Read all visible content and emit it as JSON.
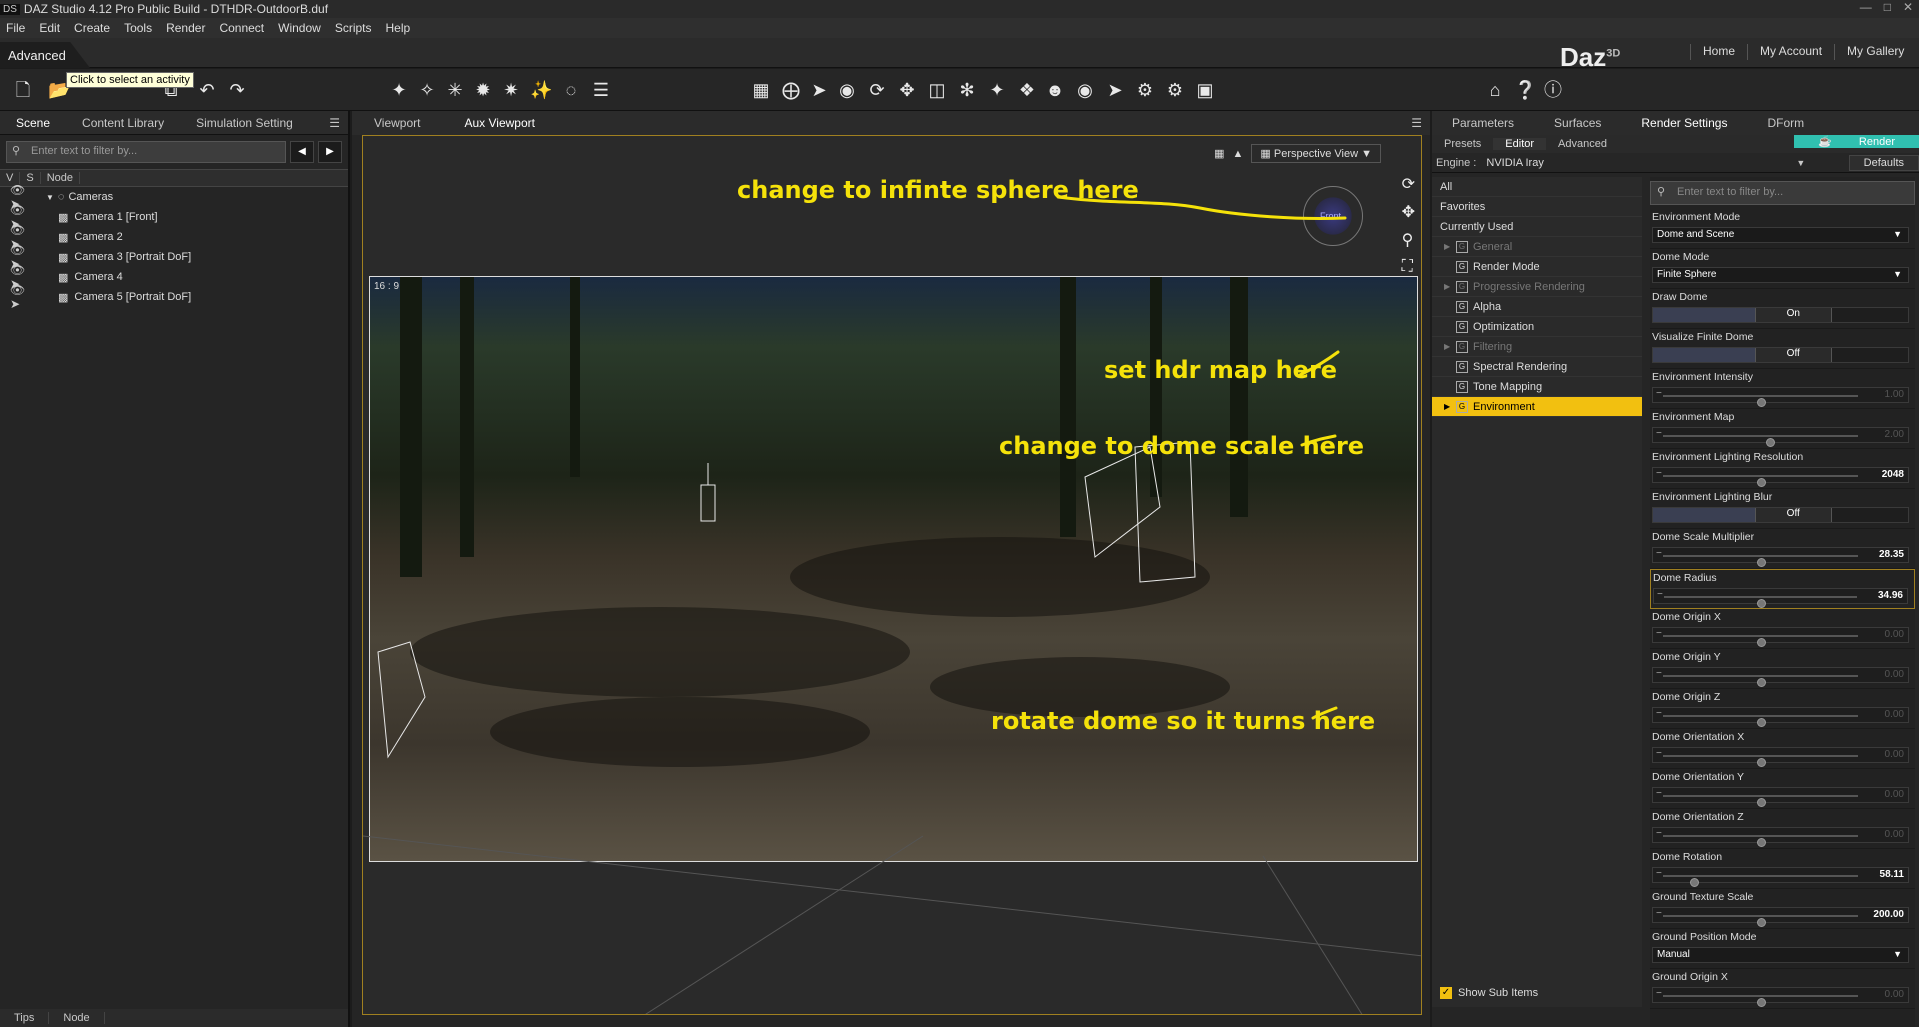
{
  "window": {
    "title": "DAZ Studio 4.12 Pro Public Build - DTHDR-OutdoorB.duf",
    "logo": "DS"
  },
  "menu": [
    "File",
    "Edit",
    "Create",
    "Tools",
    "Render",
    "Connect",
    "Window",
    "Scripts",
    "Help"
  ],
  "activity": {
    "label": "Advanced",
    "tooltip": "Click to select an activity"
  },
  "brand": {
    "name": "Daz",
    "sup": "3D"
  },
  "toplinks": [
    "Home",
    "My Account",
    "My Gallery"
  ],
  "left": {
    "tabs": [
      "Scene",
      "Content Library",
      "Simulation Setting"
    ],
    "filter_placeholder": "Enter text to filter by...",
    "columns": [
      "V",
      "S",
      "Node"
    ],
    "nodes": [
      {
        "label": "Cameras"
      },
      {
        "label": "Camera 1 [Front]"
      },
      {
        "label": "Camera 2"
      },
      {
        "label": "Camera 3 [Portrait DoF]"
      },
      {
        "label": "Camera 4"
      },
      {
        "label": "Camera 5 [Portrait DoF]"
      }
    ],
    "bottom_tabs": [
      "Tips",
      "Node"
    ]
  },
  "viewport": {
    "tabs": [
      "Viewport",
      "Aux Viewport"
    ],
    "aspect": "16 : 9",
    "view": "Perspective View",
    "navcube_label": "Front"
  },
  "right": {
    "tabs": [
      "Parameters",
      "Surfaces",
      "Render Settings",
      "DForm"
    ],
    "subtabs": [
      "Presets",
      "Editor",
      "Advanced"
    ],
    "render_button": "Render",
    "engine_label": "Engine :",
    "engine_value": "NVIDIA Iray",
    "defaults_label": "Defaults",
    "categories": [
      {
        "label": "All",
        "icon": false,
        "arrow": false,
        "dim": false
      },
      {
        "label": "Favorites",
        "icon": false,
        "arrow": false,
        "dim": false
      },
      {
        "label": "Currently Used",
        "icon": false,
        "arrow": false,
        "dim": false
      },
      {
        "label": "General",
        "icon": true,
        "arrow": true,
        "dim": true
      },
      {
        "label": "Render Mode",
        "icon": true,
        "arrow": false,
        "dim": false
      },
      {
        "label": "Progressive Rendering",
        "icon": true,
        "arrow": true,
        "dim": true
      },
      {
        "label": "Alpha",
        "icon": true,
        "arrow": false,
        "dim": false
      },
      {
        "label": "Optimization",
        "icon": true,
        "arrow": false,
        "dim": false
      },
      {
        "label": "Filtering",
        "icon": true,
        "arrow": true,
        "dim": true
      },
      {
        "label": "Spectral Rendering",
        "icon": true,
        "arrow": false,
        "dim": false
      },
      {
        "label": "Tone Mapping",
        "icon": true,
        "arrow": false,
        "dim": false
      },
      {
        "label": "Environment",
        "icon": true,
        "arrow": true,
        "dim": false,
        "selected": true
      }
    ],
    "show_sub_items": "Show Sub Items",
    "prop_filter_placeholder": "Enter text to filter by...",
    "properties": [
      {
        "label": "Environment Mode",
        "kind": "drop",
        "value": "Dome and Scene"
      },
      {
        "label": "Dome Mode",
        "kind": "drop",
        "value": "Finite Sphere"
      },
      {
        "label": "Draw Dome",
        "kind": "toggle",
        "value": "On"
      },
      {
        "label": "Visualize Finite Dome",
        "kind": "toggle",
        "value": "Off"
      },
      {
        "label": "Environment Intensity",
        "kind": "slider",
        "value": "1.00",
        "dim": true,
        "pos": 0.5
      },
      {
        "label": "Environment Map",
        "kind": "slider",
        "value": "2.00",
        "dim": true,
        "pos": 0.55
      },
      {
        "label": "Environment Lighting Resolution",
        "kind": "slider",
        "value": "2048",
        "dim": false,
        "pos": 0.5
      },
      {
        "label": "Environment Lighting Blur",
        "kind": "toggle",
        "value": "Off"
      },
      {
        "label": "Dome Scale Multiplier",
        "kind": "slider",
        "value": "28.35",
        "dim": false,
        "pos": 0.5
      },
      {
        "label": "Dome Radius",
        "kind": "slider",
        "value": "34.96",
        "dim": false,
        "pos": 0.5,
        "highlight": true
      },
      {
        "label": "Dome Origin X",
        "kind": "slider",
        "value": "0.00",
        "dim": true,
        "pos": 0.5
      },
      {
        "label": "Dome Origin Y",
        "kind": "slider",
        "value": "0.00",
        "dim": true,
        "pos": 0.5
      },
      {
        "label": "Dome Origin Z",
        "kind": "slider",
        "value": "0.00",
        "dim": true,
        "pos": 0.5
      },
      {
        "label": "Dome Orientation X",
        "kind": "slider",
        "value": "0.00",
        "dim": true,
        "pos": 0.5
      },
      {
        "label": "Dome Orientation Y",
        "kind": "slider",
        "value": "0.00",
        "dim": true,
        "pos": 0.5
      },
      {
        "label": "Dome Orientation Z",
        "kind": "slider",
        "value": "0.00",
        "dim": true,
        "pos": 0.5
      },
      {
        "label": "Dome Rotation",
        "kind": "slider",
        "value": "58.11",
        "dim": false,
        "pos": 0.16
      },
      {
        "label": "Ground Texture Scale",
        "kind": "slider",
        "value": "200.00",
        "dim": false,
        "pos": 0.5
      },
      {
        "label": "Ground Position Mode",
        "kind": "drop",
        "value": "Manual"
      },
      {
        "label": "Ground Origin X",
        "kind": "slider",
        "value": "0.00",
        "dim": true,
        "pos": 0.5
      }
    ]
  },
  "annotations": [
    "change to infinte sphere here",
    "set hdr map here",
    "change to dome scale here",
    "rotate dome so it turns here"
  ],
  "colors": {
    "accent": "#f2c010",
    "annotation": "#f5e20a",
    "render": "#30c0b0"
  }
}
